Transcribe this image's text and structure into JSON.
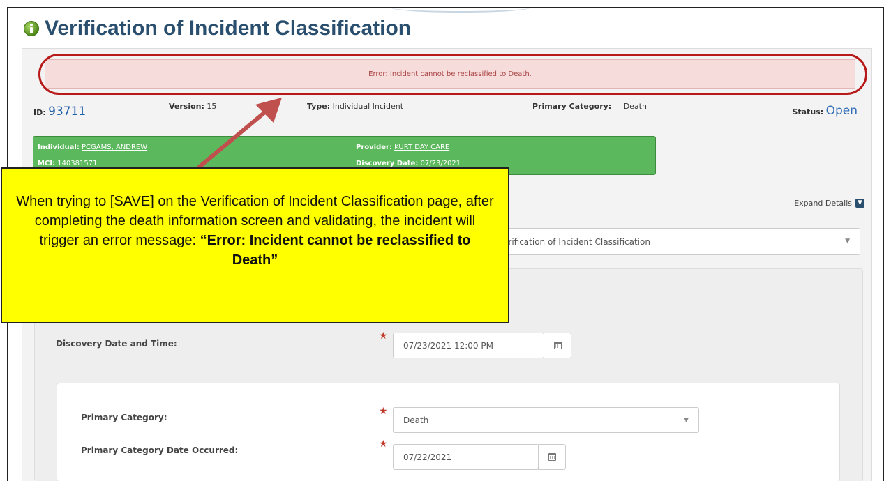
{
  "page": {
    "title": "Verification of Incident Classification"
  },
  "error": {
    "message": "Error: Incident cannot be reclassified to Death."
  },
  "meta": {
    "id_label": "ID:",
    "id_value": "93711",
    "version_label": "Version:",
    "version_value": "15",
    "type_label": "Type:",
    "type_value": "Individual Incident",
    "category_label": "Primary Category:",
    "category_value": "Death",
    "status_label": "Status:",
    "status_value": "Open"
  },
  "summary_card": {
    "individual_label": "Individual:",
    "individual_value": "PCGAMS, ANDREW",
    "mci_label": "MCI:",
    "mci_value": "140381571",
    "provider_label": "Provider:",
    "provider_value": "KURT DAY CARE",
    "discovery_label": "Discovery Date:",
    "discovery_value": "07/23/2021"
  },
  "toolbar": {
    "expand_details_label": "Expand Details"
  },
  "step_select": {
    "value": "erification of Incident Classification"
  },
  "form": {
    "discovery_label": "Discovery Date and Time:",
    "discovery_value": "07/23/2021 12:00 PM",
    "primary_category_label": "Primary Category:",
    "primary_category_value": "Death",
    "date_occurred_label": "Primary Category Date Occurred:",
    "date_occurred_value": "07/22/2021"
  },
  "callout": {
    "text": "When trying to [SAVE] on the Verification of Incident Classification page, after completing the death information screen and validating, the incident will trigger an error message: ",
    "emphasis": "“Error: Incident cannot be reclassified to Death”"
  },
  "colors": {
    "title": "#2a4f6e",
    "error_bg": "#f7dcdc",
    "error_text": "#a94442",
    "highlight_ring": "#b81a1a",
    "card_green": "#5cb85c",
    "callout_yellow": "#ffff00",
    "arrow": "#c0504d",
    "link": "#1f5fa8"
  }
}
